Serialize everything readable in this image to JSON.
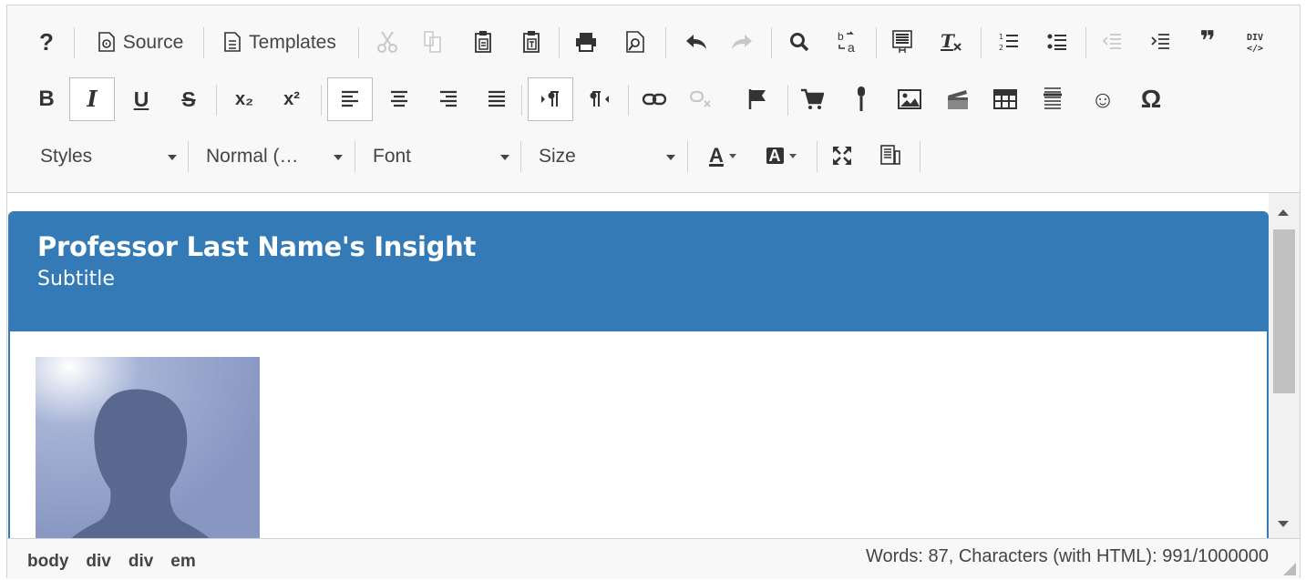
{
  "toolbar": {
    "source_label": "Source",
    "templates_label": "Templates",
    "help_glyph": "?",
    "bold_glyph": "B",
    "italic_glyph": "I",
    "underline_glyph": "U",
    "strike_glyph": "S",
    "subscript_glyph": "x₂",
    "superscript_glyph": "x²",
    "quote_glyph": "❞",
    "omega_glyph": "Ω",
    "smiley_glyph": "☺",
    "styles_label": "Styles",
    "format_label": "Normal (…",
    "font_label": "Font",
    "size_label": "Size",
    "text_color_glyph": "A",
    "bg_color_glyph": "A"
  },
  "card": {
    "title": "Professor Last Name's Insight",
    "subtitle": "Subtitle"
  },
  "status": {
    "path": [
      "body",
      "div",
      "div",
      "em"
    ],
    "wordcount": "Words: 87, Characters (with HTML): 991/1000000"
  },
  "colors": {
    "header_blue": "#337ab7",
    "toolbar_bg": "#f8f8f8",
    "avatar_bg": "#8b9bc5"
  },
  "icons": [
    "help-icon",
    "source-icon",
    "templates-icon",
    "cut-icon",
    "copy-icon",
    "paste-icon",
    "paste-text-icon",
    "paste-word-icon",
    "print-icon",
    "find-icon",
    "replace-icon",
    "select-all-icon",
    "remove-format-icon",
    "numbered-list-icon",
    "bulleted-list-icon",
    "outdent-icon",
    "indent-icon",
    "blockquote-icon",
    "div-icon",
    "undo-icon",
    "redo-icon",
    "link-icon",
    "unlink-icon",
    "anchor-icon",
    "cart-icon",
    "mic-icon",
    "image-icon",
    "video-icon",
    "table-icon",
    "hr-icon",
    "smiley-icon",
    "special-char-icon",
    "maximize-icon",
    "show-blocks-icon"
  ]
}
